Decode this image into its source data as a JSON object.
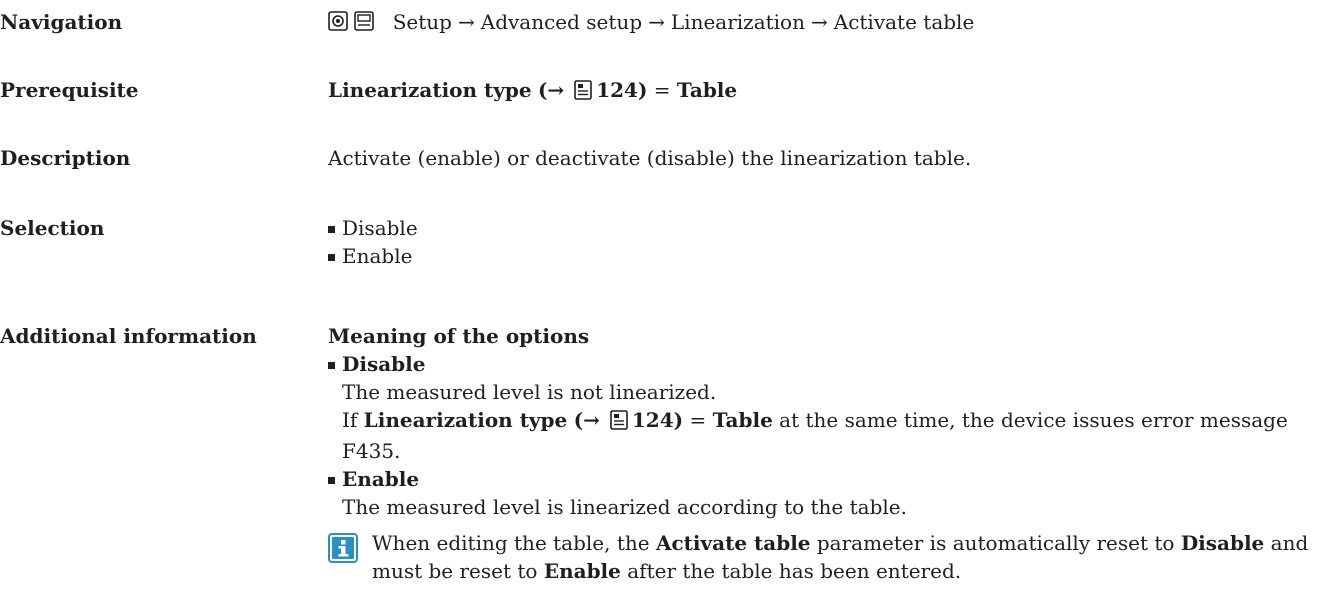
{
  "navigation": {
    "label": "Navigation",
    "icons": [
      "operation-menu-icon",
      "display-menu-icon"
    ],
    "path": [
      "Setup",
      "Advanced setup",
      "Linearization",
      "Activate table"
    ],
    "separator": "→"
  },
  "prerequisite": {
    "label": "Prerequisite",
    "param": "Linearization type",
    "ref_open": "(→",
    "ref_page": "124",
    "ref_close": ")",
    "equals": "=",
    "value": "Table"
  },
  "description": {
    "label": "Description",
    "text": "Activate (enable) or deactivate (disable) the linearization table."
  },
  "selection": {
    "label": "Selection",
    "options": [
      "Disable",
      "Enable"
    ]
  },
  "additional": {
    "label": "Additional information",
    "heading": "Meaning of the options",
    "disable": {
      "title": "Disable",
      "line1": "The measured level is not linearized.",
      "if_word": "If",
      "param": "Linearization type",
      "ref_open": "(→",
      "ref_page": "124",
      "ref_close": ")",
      "equals": "=",
      "value": "Table",
      "rest": "at the same time, the device issues error message F435."
    },
    "enable": {
      "title": "Enable",
      "line1": "The measured level is linearized according to the table."
    },
    "note": {
      "icon": "info-icon",
      "part1": "When editing the table, the",
      "param": "Activate table",
      "part2": "parameter is automatically reset to",
      "value1": "Disable",
      "part3": "and must be reset to",
      "value2": "Enable",
      "part4": "after the table has been entered."
    }
  }
}
